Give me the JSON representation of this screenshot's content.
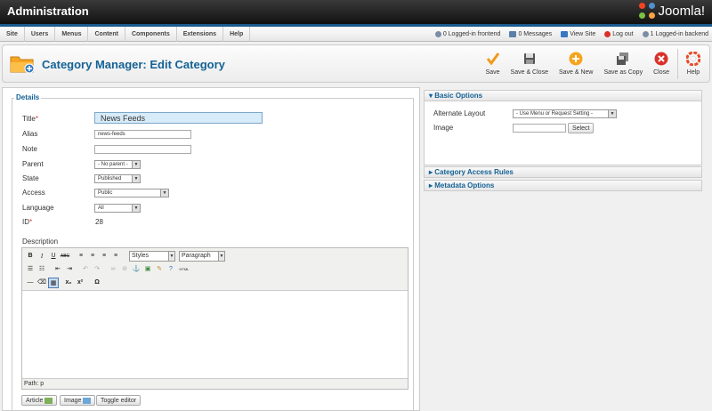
{
  "header": {
    "title": "Administration",
    "logo_text": "Joomla!"
  },
  "menubar": {
    "items": [
      "Site",
      "Users",
      "Menus",
      "Content",
      "Components",
      "Extensions",
      "Help"
    ],
    "status": {
      "logged_frontend": "0 Logged-in frontend",
      "messages": "0 Messages",
      "view_site": "View Site",
      "logout": "Log out",
      "logged_backend": "1 Logged-in backend"
    }
  },
  "toolbar": {
    "page_title": "Category Manager: Edit Category",
    "save": "Save",
    "save_close": "Save & Close",
    "save_new": "Save & New",
    "save_copy": "Save as Copy",
    "close": "Close",
    "help": "Help"
  },
  "details": {
    "legend": "Details",
    "title_label": "Title",
    "title_value": "News Feeds",
    "alias_label": "Alias",
    "alias_value": "news-feeds",
    "note_label": "Note",
    "note_value": "",
    "parent_label": "Parent",
    "parent_value": "- No parent -",
    "state_label": "State",
    "state_value": "Published",
    "access_label": "Access",
    "access_value": "Public",
    "language_label": "Language",
    "language_value": "All",
    "id_label": "ID",
    "id_value": "28",
    "required_mark": "*",
    "description_label": "Description"
  },
  "editor": {
    "styles": "Styles",
    "format": "Paragraph",
    "path": "Path: p",
    "html_label": "HTML",
    "buttons": {
      "article": "Article",
      "image": "Image",
      "toggle": "Toggle editor"
    }
  },
  "right": {
    "basic_options": "Basic Options",
    "alt_layout_label": "Alternate Layout",
    "alt_layout_value": "- Use Menu or Request Setting -",
    "image_label": "Image",
    "select_button": "Select",
    "access_rules": "Category Access Rules",
    "metadata": "Metadata Options"
  },
  "colors": {
    "accent": "#146295",
    "header_bg": "#111111",
    "required": "#dd3333"
  }
}
